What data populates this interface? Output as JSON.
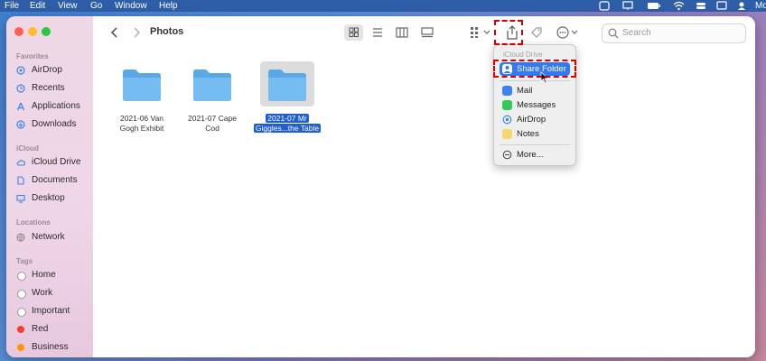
{
  "menubar": {
    "items": [
      "File",
      "Edit",
      "View",
      "Go",
      "Window",
      "Help"
    ],
    "right_text": "Mo"
  },
  "sidebar": {
    "favorites_header": "Favorites",
    "favorites": [
      {
        "label": "AirDrop",
        "icon": "airdrop-icon"
      },
      {
        "label": "Recents",
        "icon": "clock-icon"
      },
      {
        "label": "Applications",
        "icon": "applications-icon"
      },
      {
        "label": "Downloads",
        "icon": "download-icon"
      }
    ],
    "icloud_header": "iCloud",
    "icloud": [
      {
        "label": "iCloud Drive",
        "icon": "cloud-icon"
      },
      {
        "label": "Documents",
        "icon": "document-icon"
      },
      {
        "label": "Desktop",
        "icon": "desktop-icon"
      }
    ],
    "locations_header": "Locations",
    "locations": [
      {
        "label": "Network",
        "icon": "network-icon"
      }
    ],
    "tags_header": "Tags",
    "tags": [
      {
        "label": "Home",
        "color": "#ffffff"
      },
      {
        "label": "Work",
        "color": "#ffffff"
      },
      {
        "label": "Important",
        "color": "#ffffff"
      },
      {
        "label": "Red",
        "color": "#ff3b30"
      },
      {
        "label": "Business",
        "color": "#ff9500"
      }
    ]
  },
  "toolbar": {
    "title": "Photos",
    "search_placeholder": "Search"
  },
  "folders": [
    {
      "line1": "2021-06 Van",
      "line2": "Gogh Exhibit",
      "selected": false
    },
    {
      "line1": "2021-07 Cape",
      "line2": "Cod",
      "selected": false
    },
    {
      "line1": "2021-07 Mr",
      "line2": "Giggles...the Table",
      "selected": true
    }
  ],
  "share_menu": {
    "header": "iCloud Drive",
    "share_folder": "Share Folder",
    "items": [
      {
        "label": "Mail",
        "color": "#3b82f6"
      },
      {
        "label": "Messages",
        "color": "#34c759"
      },
      {
        "label": "AirDrop",
        "color": "#2f80ed"
      },
      {
        "label": "Notes",
        "color": "#f5d76e"
      }
    ],
    "more": "More..."
  },
  "colors": {
    "accent": "#3478f6",
    "highlight_dashes": "#d40000",
    "folder_blue": "#6ab3ea"
  }
}
